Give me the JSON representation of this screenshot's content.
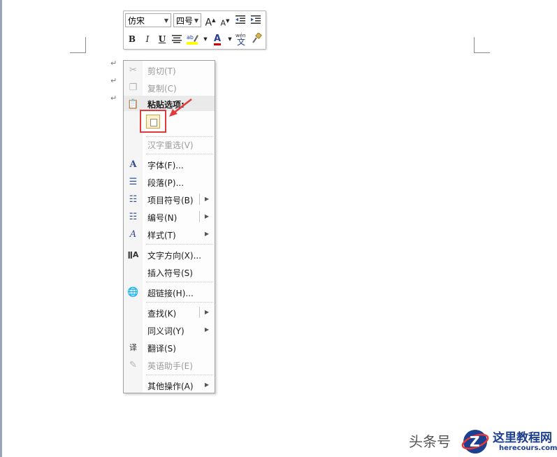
{
  "mini_toolbar": {
    "font_name": "仿宋",
    "font_size": "四号",
    "grow_font": "A",
    "shrink_font": "A",
    "bold": "B",
    "italic": "I",
    "underline": "U",
    "font_color_letter": "A",
    "phonetic_top": "wén",
    "phonetic_char": "文"
  },
  "paragraph_marks": [
    "↵",
    "↵",
    "↵"
  ],
  "context_menu": {
    "cut": "剪切(T)",
    "copy": "复制(C)",
    "paste_options": "粘贴选项:",
    "reconvert": "汉字重选(V)",
    "font": "字体(F)...",
    "paragraph": "段落(P)...",
    "bullets": "项目符号(B)",
    "numbering": "编号(N)",
    "styles": "样式(T)",
    "text_direction": "文字方向(X)...",
    "insert_symbol": "插入符号(S)",
    "hyperlink": "超链接(H)...",
    "lookup": "查找(K)",
    "synonyms": "同义词(Y)",
    "translate": "翻译(S)",
    "english_assistant": "英语助手(E)",
    "other_actions": "其他操作(A)"
  },
  "watermark": {
    "source": "头条号",
    "brand": "这里教程网",
    "url": "herecours.com"
  },
  "colors": {
    "highlight_red": "#e23a3a",
    "font_color_red": "#d40000",
    "highlight_yellow": "#ffff00",
    "brand_blue": "#1d3f8f"
  }
}
